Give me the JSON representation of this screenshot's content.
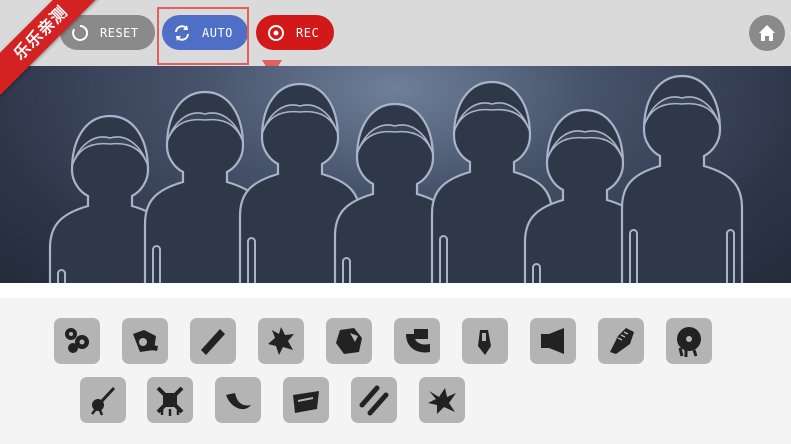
{
  "toolbar": {
    "reset_label": "RESET",
    "auto_label": "AUTO",
    "rec_label": "REC"
  },
  "watermark": "乐乐亲测",
  "icons": {
    "reset": "reset-icon",
    "auto": "refresh-icon",
    "record": "record-icon",
    "home": "home-icon"
  },
  "colors": {
    "topbar": "#dadada",
    "reset_button": "#8a8a8a",
    "auto_button": "#4f6fc6",
    "rec_button": "#d21818",
    "highlight": "#e0605e",
    "sound_tile": "#b4b4b4"
  },
  "stage": {
    "characters": [
      "character-1",
      "character-2",
      "character-3",
      "character-4",
      "character-5",
      "character-6",
      "character-7"
    ]
  },
  "sounds": {
    "row1": [
      "sound-1",
      "sound-2",
      "sound-3",
      "sound-4",
      "sound-5",
      "sound-6",
      "sound-7",
      "sound-8",
      "sound-9",
      "sound-10"
    ],
    "row2": [
      "sound-11",
      "sound-12",
      "sound-13",
      "sound-14",
      "sound-15",
      "sound-16"
    ]
  }
}
